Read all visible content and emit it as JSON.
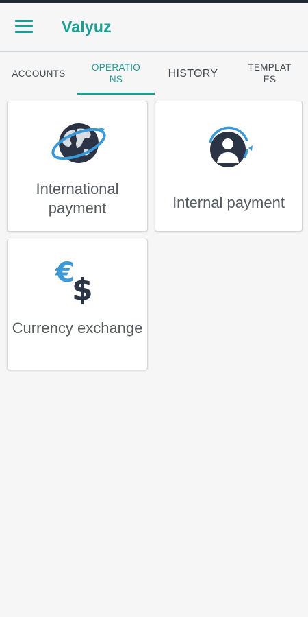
{
  "app": {
    "title": "Valyuz"
  },
  "tabs": [
    {
      "label": "ACCOUNTS",
      "active": false
    },
    {
      "label": "OPERATIONS",
      "active": true
    },
    {
      "label": "HISTORY",
      "active": false
    },
    {
      "label": "TEMPLATES",
      "active": false
    }
  ],
  "operations": [
    {
      "label": "International payment",
      "icon": "globe-icon"
    },
    {
      "label": "Internal payment",
      "icon": "user-transfer-icon"
    },
    {
      "label": "Currency exchange",
      "icon": "currency-exchange-icon"
    }
  ],
  "colors": {
    "accent": "#17a096",
    "icon_blue": "#3a9ad9",
    "icon_dark": "#2b3445"
  }
}
